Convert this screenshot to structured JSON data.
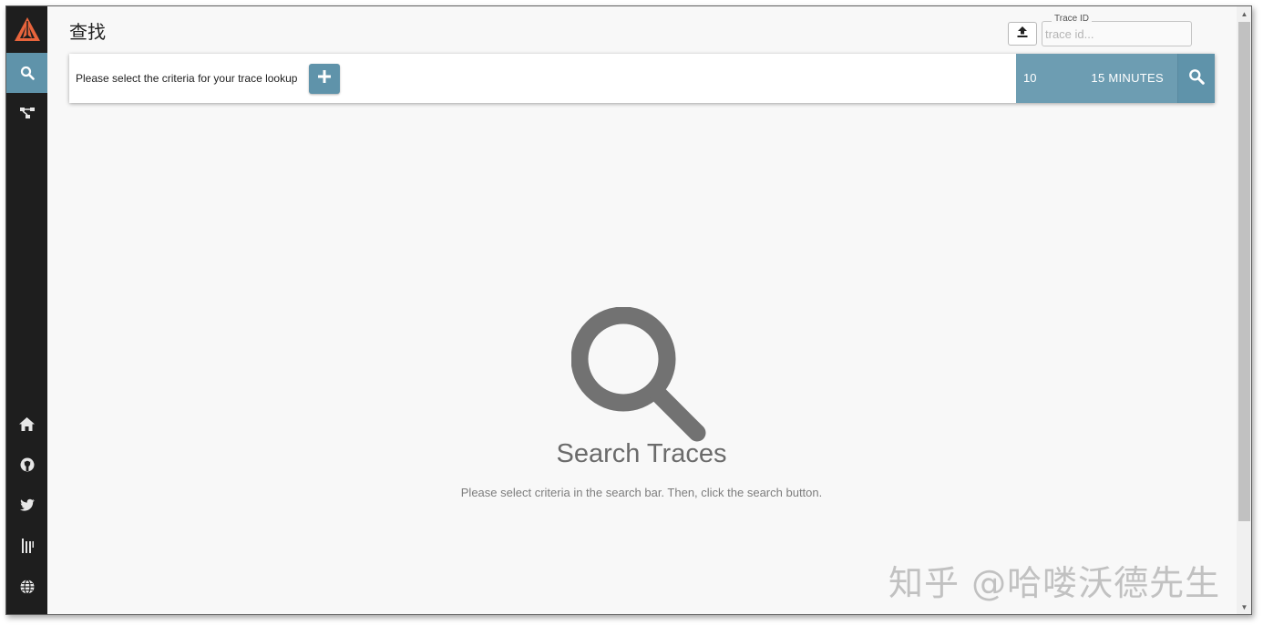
{
  "header": {
    "title": "查找",
    "upload_icon": "upload-icon",
    "trace_id": {
      "legend": "Trace ID",
      "placeholder": "trace id...",
      "value": ""
    }
  },
  "sidebar": {
    "logo_icon": "zipkin-logo",
    "top_items": [
      {
        "name": "search",
        "icon": "search-icon",
        "active": true
      },
      {
        "name": "dependencies",
        "icon": "dependencies-icon",
        "active": false
      }
    ],
    "bottom_items": [
      {
        "name": "home",
        "icon": "home-icon"
      },
      {
        "name": "github",
        "icon": "github-icon"
      },
      {
        "name": "twitter",
        "icon": "twitter-icon"
      },
      {
        "name": "gitter",
        "icon": "gitter-icon"
      },
      {
        "name": "language",
        "icon": "globe-icon"
      }
    ]
  },
  "searchbar": {
    "criteria_prompt": "Please select the criteria for your trace lookup",
    "add_icon": "plus-icon",
    "limit": "10",
    "lookback": "15 MINUTES",
    "search_icon": "search-icon"
  },
  "empty_state": {
    "icon": "search-icon",
    "title": "Search Traces",
    "subtitle": "Please select criteria in the search bar. Then, click the search button."
  },
  "scrollbar": {
    "up": "▲",
    "down": "▼"
  },
  "watermark": "知乎 @哈喽沃德先生",
  "colors": {
    "sidebar": "#1e1e1e",
    "accent": "#5f93aa",
    "limit_bg": "#6d9db2",
    "logo": "#e8643c",
    "background": "#f8f8f8"
  }
}
